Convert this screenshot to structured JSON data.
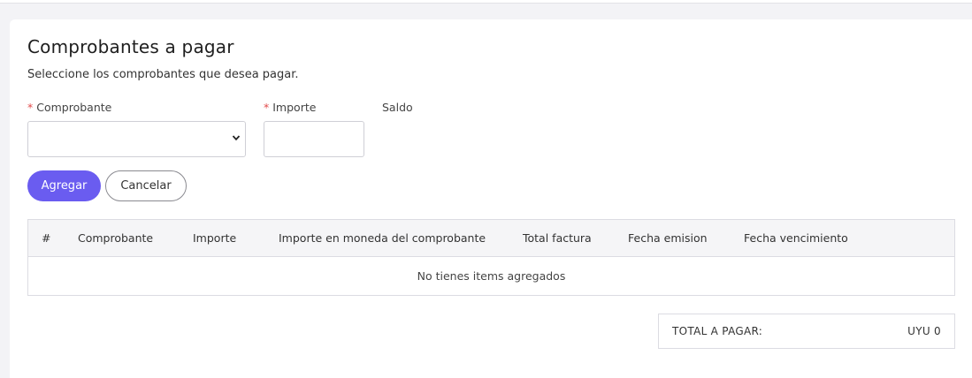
{
  "section": {
    "title": "Comprobantes a pagar",
    "subtitle": "Seleccione los comprobantes que desea pagar."
  },
  "form": {
    "required_mark": "*",
    "comprobante_label": "Comprobante",
    "comprobante_value": "",
    "importe_label": "Importe",
    "importe_value": "",
    "saldo_label": "Saldo"
  },
  "buttons": {
    "add": "Agregar",
    "cancel": "Cancelar"
  },
  "table": {
    "columns": [
      "#",
      "Comprobante",
      "Importe",
      "Importe en moneda del comprobante",
      "Total factura",
      "Fecha emision",
      "Fecha vencimiento"
    ],
    "empty_message": "No tienes items agregados"
  },
  "totals": {
    "label": "TOTAL A PAGAR:",
    "value": "UYU 0"
  },
  "colors": {
    "primary": "#6a5cf0",
    "required": "#e24a4a"
  }
}
